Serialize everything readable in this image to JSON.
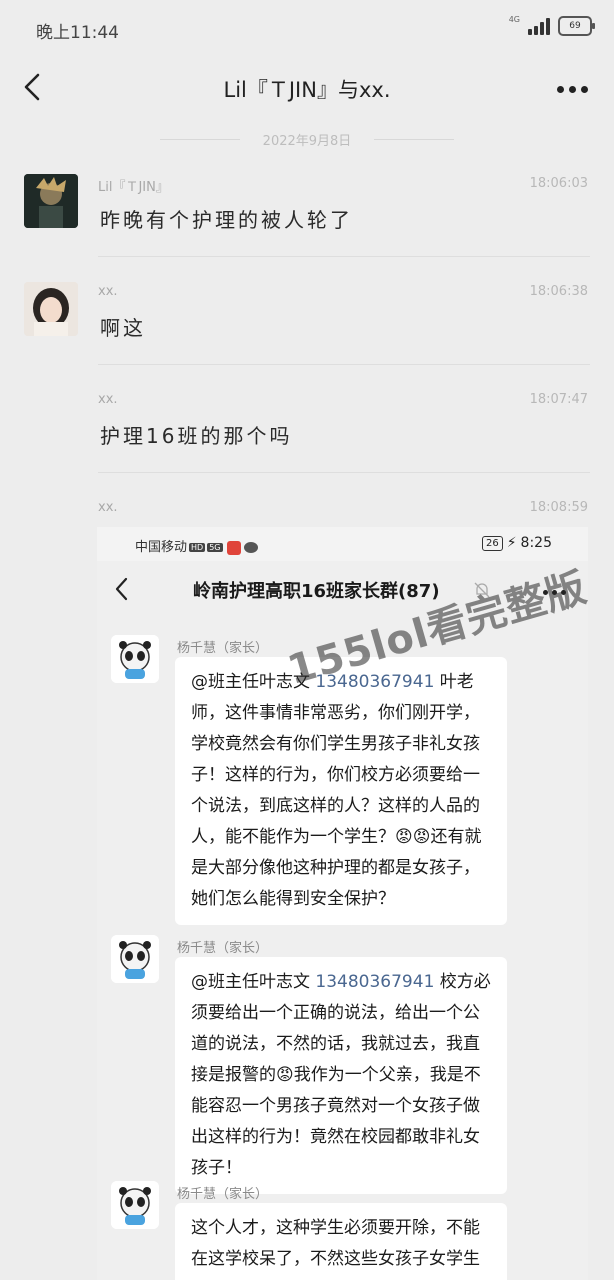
{
  "status_bar": {
    "time": "晚上11:44",
    "network": "4G",
    "battery": "69"
  },
  "header": {
    "title": "Lil『ＴJIN』与xx."
  },
  "date_divider": "2022年9月8日",
  "messages": [
    {
      "sender": "Lil『ＴJIN』",
      "time": "18:06:03",
      "text": "昨晚有个护理的被人轮了"
    },
    {
      "sender": "xx.",
      "time": "18:06:38",
      "text": "啊这"
    },
    {
      "sender": "xx.",
      "time": "18:07:47",
      "text": "护理16班的那个吗"
    },
    {
      "sender": "xx.",
      "time": "18:08:59",
      "text": ""
    }
  ],
  "screenshot": {
    "status_bar": {
      "carrier": "中国移动",
      "hd": "HD",
      "net": "5G",
      "battery": "26",
      "time": "8:25"
    },
    "group_title": "岭南护理高职16班家长群(87)",
    "messages": [
      {
        "sender": "杨千慧（家长）",
        "mention": "@班主任叶志文 ",
        "phone": "13480367941",
        "text": " 叶老师，这件事情非常恶劣，你们刚开学，学校竟然会有你们学生男孩子非礼女孩子！这样的行为，你们校方必须要给一个说法，到底这样的人？这样的人品的人，能不能作为一个学生？😡😡还有就是大部分像他这种护理的都是女孩子，她们怎么能得到安全保护？"
      },
      {
        "sender": "杨千慧（家长）",
        "mention": "@班主任叶志文 ",
        "phone": "13480367941",
        "text": " 校方必须要给出一个正确的说法，给出一个公道的说法，不然的话，我就过去，我直接是报警的😡我作为一个父亲，我是不能容忍一个男孩子竟然对一个女孩子做出这样的行为！竟然在校园都敢非礼女孩子！"
      },
      {
        "sender": "杨千慧（家长）",
        "text": "这个人才，这种学生必须要开除，不能在这学校呆了，不然这些女孩子女学生都是不安全，这种学生就"
      }
    ]
  },
  "watermark": "155lol看完整版"
}
